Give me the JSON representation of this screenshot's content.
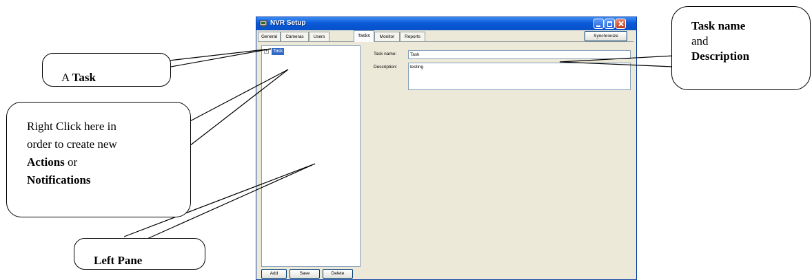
{
  "window": {
    "title": "NVR Setup",
    "tabs": [
      {
        "label": "General"
      },
      {
        "label": "Cameras"
      },
      {
        "label": "Users"
      },
      {
        "label": "Tasks",
        "active": true
      },
      {
        "label": "Monitor"
      },
      {
        "label": "Reports"
      }
    ],
    "synchronize_label": "Synchronize",
    "tree": {
      "node_label": "Task",
      "expander": "+"
    },
    "buttons": {
      "add": "Add",
      "save": "Save",
      "delete": "Delete"
    },
    "form": {
      "task_name_label": "Task name:",
      "task_name_value": "Task",
      "description_label": "Description:",
      "description_value": "testing"
    }
  },
  "callouts": {
    "task": {
      "prefix": "A ",
      "bold": "Task"
    },
    "right_click": {
      "line1": "Right Click here in",
      "line2": "order to create new",
      "actions": "Actions",
      "or": " or",
      "notifications": "Notifications"
    },
    "left_pane": {
      "bold": "Left Pane"
    },
    "task_name": {
      "bold1": "Task name",
      "and": "and",
      "bold2": "Description"
    }
  },
  "colors": {
    "titlebar": "#0a5ad8",
    "selection": "#316ac5",
    "window_bg": "#ece9d8"
  }
}
